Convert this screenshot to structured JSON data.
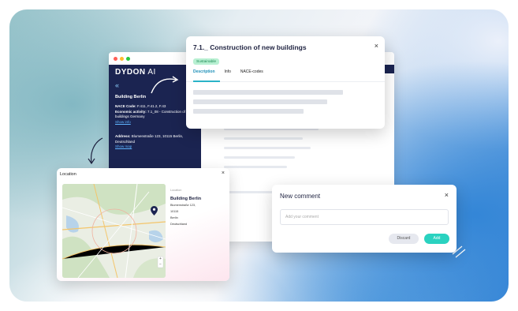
{
  "app": {
    "logo_main": "DYDON",
    "logo_suffix": " AI",
    "back": "«",
    "building_title": "Building Berlin",
    "nace_label": "NACE Code:",
    "nace_value": " F.411, F.41.2, F.43",
    "econ_label": "Economic activity:",
    "econ_value": " 7.1_08 - Construction of new buildings Germany",
    "show_info": "Show info",
    "address_label": "Address:",
    "address_value": " Blumenstraße 123, 10115 Berlin, Deutschland",
    "show_map": "Show map"
  },
  "activity_modal": {
    "title": "7.1._ Construction of new buildings",
    "close": "×",
    "badge": "Sustainable",
    "tabs": [
      "Description",
      "Info",
      "NACE-codes"
    ]
  },
  "location_modal": {
    "title": "Location",
    "close": "×",
    "label": "Location",
    "name": "Building Berlin",
    "address_lines": [
      "Blumenstraße 123,",
      "10115",
      "Berlin",
      "Deutschland"
    ],
    "zoom_in": "+",
    "zoom_out": "−"
  },
  "comment_modal": {
    "title": "New comment",
    "close": "×",
    "placeholder": "Add your comment",
    "discard": "Discard",
    "add": "Add"
  },
  "colors": {
    "sidebar_bg": "#1b2451",
    "accent_teal": "#2ad2c0",
    "sustainable_bg": "#b8f0d2"
  },
  "icons": [
    "window-close-dot",
    "window-min-dot",
    "window-max-dot",
    "map-pin-icon",
    "curved-arrow-icon",
    "close-icon"
  ]
}
